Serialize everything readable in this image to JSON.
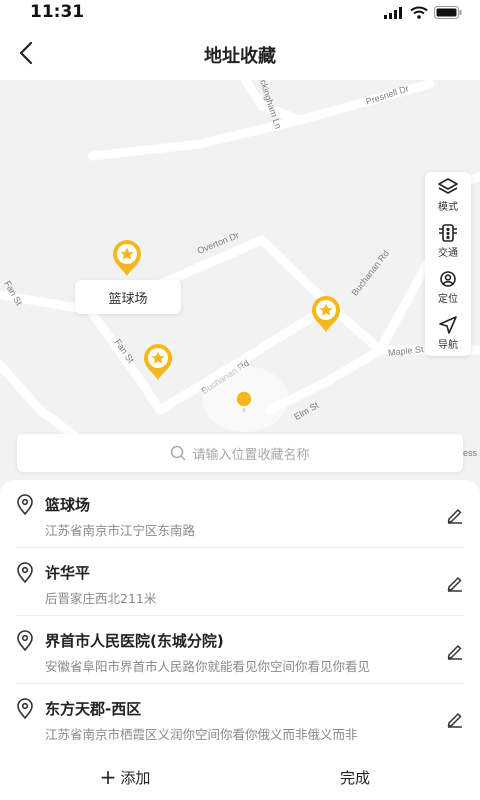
{
  "status_bar": {
    "time": "11:31"
  },
  "header": {
    "title": "地址收藏",
    "back_icon": "chevron-left-icon"
  },
  "map": {
    "streets": [
      "Presnell Dr",
      "Buckingham Ln",
      "Overton Dr",
      "Buchanan Rd",
      "Fan St",
      "Buchanan Rd",
      "Maple St",
      "Elm St",
      "Fan St",
      "ess"
    ],
    "tooltip": "篮球场",
    "tools": [
      {
        "label": "模式",
        "icon": "layers-icon"
      },
      {
        "label": "交通",
        "icon": "traffic-light-icon"
      },
      {
        "label": "定位",
        "icon": "locate-icon"
      },
      {
        "label": "导航",
        "icon": "navigation-arrow-icon"
      }
    ],
    "pin_color": "#F5B81C"
  },
  "search": {
    "placeholder": "请输入位置收藏名称"
  },
  "favorites": [
    {
      "name": "篮球场",
      "address": "江苏省南京市江宁区东南路"
    },
    {
      "name": "许华平",
      "address": "后晋家庄西北211米"
    },
    {
      "name": "界首市人民医院(东城分院)",
      "address": "安徽省阜阳市界首市人民路你就能看见你空间你看见你看见"
    },
    {
      "name": "东方天郡-西区",
      "address": "江苏省南京市栖霞区义润你空间你看你俄义而非俄义而非"
    }
  ],
  "footer": {
    "add_label": "添加",
    "done_label": "完成"
  }
}
